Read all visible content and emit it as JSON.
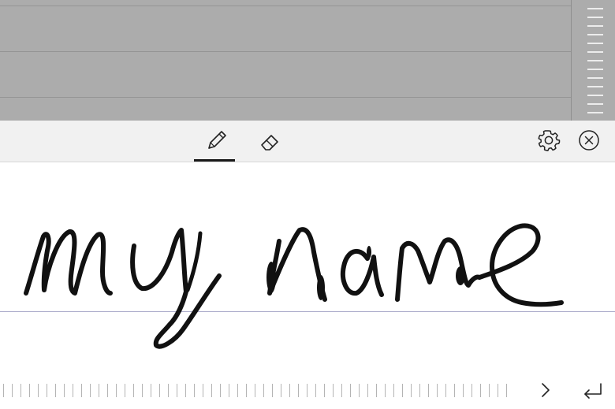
{
  "panel": {
    "tools": [
      {
        "name": "pen",
        "icon": "pen-icon",
        "selected": true
      },
      {
        "name": "eraser",
        "icon": "eraser-icon",
        "selected": false
      }
    ],
    "settings_icon": "gear-icon",
    "close_icon": "close-circle-icon"
  },
  "writing": {
    "ink_text": "my name"
  },
  "bottom": {
    "next_icon": "chevron-right-icon",
    "enter_icon": "return-icon"
  },
  "colors": {
    "document_background": "#acacac",
    "toolbar_background": "#f1f1f1",
    "ink": "#111111",
    "baseline": "#a8a8c8"
  }
}
